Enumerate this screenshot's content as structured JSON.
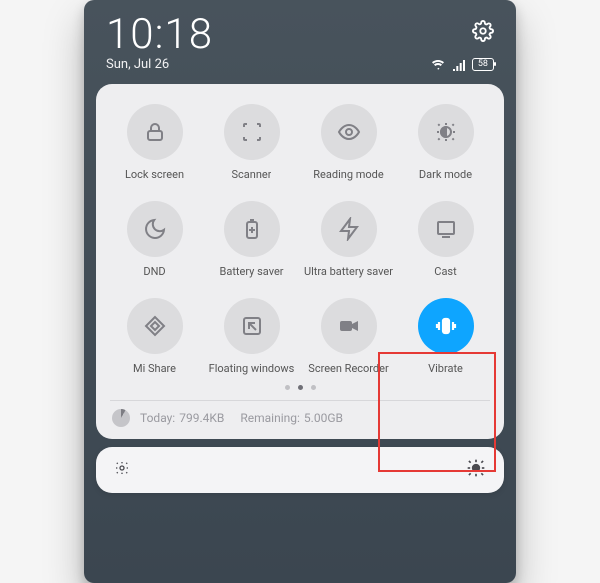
{
  "status": {
    "time": "10:18",
    "date": "Sun, Jul 26",
    "battery": "58"
  },
  "tiles": [
    {
      "label": "Lock screen",
      "icon": "lock-icon",
      "active": false
    },
    {
      "label": "Scanner",
      "icon": "scanner-icon",
      "active": false
    },
    {
      "label": "Reading mode",
      "icon": "eye-icon",
      "active": false
    },
    {
      "label": "Dark mode",
      "icon": "dark-mode-icon",
      "active": false
    },
    {
      "label": "DND",
      "icon": "moon-icon",
      "active": false
    },
    {
      "label": "Battery saver",
      "icon": "battery-plus-icon",
      "active": false
    },
    {
      "label": "Ultra battery saver",
      "icon": "bolt-icon",
      "active": false
    },
    {
      "label": "Cast",
      "icon": "cast-icon",
      "active": false
    },
    {
      "label": "Mi Share",
      "icon": "mi-share-icon",
      "active": false
    },
    {
      "label": "Floating windows",
      "icon": "floating-window-icon",
      "active": false
    },
    {
      "label": "Screen Recorder",
      "icon": "video-icon",
      "active": false
    },
    {
      "label": "Vibrate",
      "icon": "vibrate-icon",
      "active": true
    }
  ],
  "highlight_index": 10,
  "pager": {
    "count": 3,
    "active": 1
  },
  "data_usage": {
    "today_label": "Today:",
    "today_value": "799.4KB",
    "remaining_label": "Remaining:",
    "remaining_value": "5.00GB"
  },
  "colors": {
    "accent": "#0ea5ff",
    "highlight": "#e53935"
  }
}
